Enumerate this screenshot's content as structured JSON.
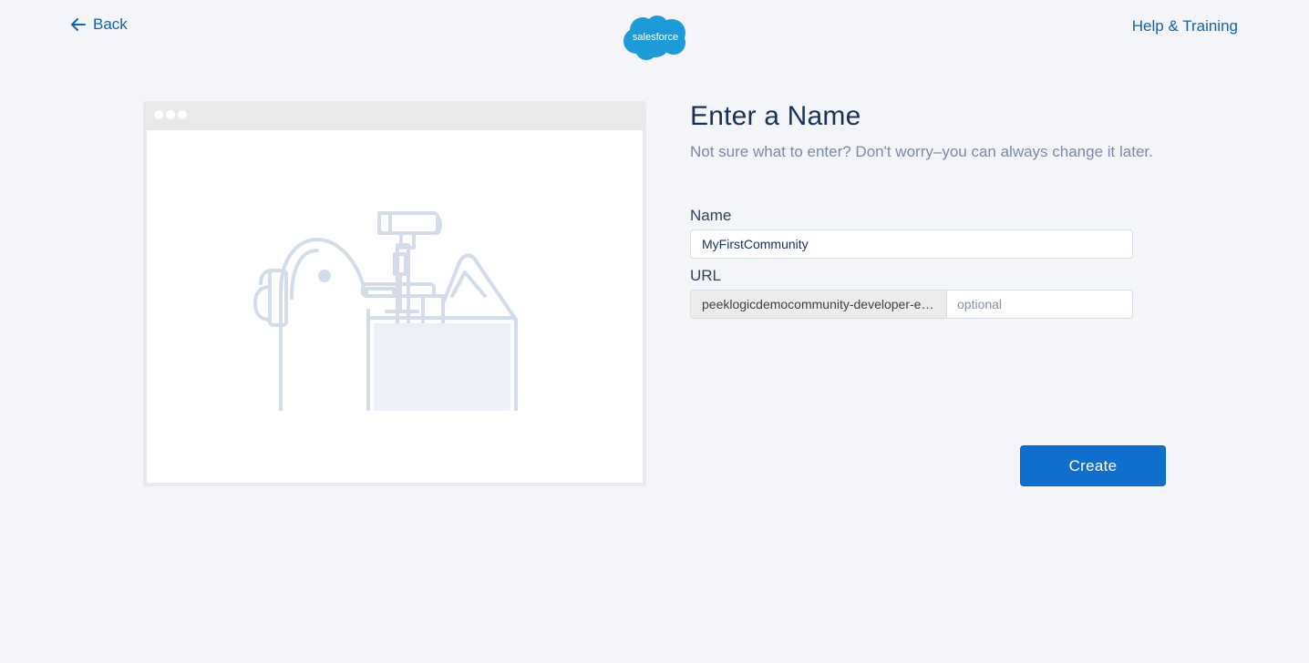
{
  "header": {
    "back_label": "Back",
    "logo_text": "salesforce",
    "help_label": "Help & Training"
  },
  "preview": {
    "illustration_icon": "toolbox-illustration"
  },
  "form": {
    "heading": "Enter a Name",
    "subheading": "Not sure what to enter? Don't worry–you can always change it later.",
    "name_label": "Name",
    "name_value": "MyFirstCommunity",
    "url_label": "URL",
    "url_prefix": "peeklogicdemocommunity-developer-edition...",
    "url_placeholder": "optional",
    "create_label": "Create"
  },
  "colors": {
    "accent": "#0e6fcf",
    "link": "#0b64b5",
    "background": "#f3f5f9",
    "logo_blue": "#1798c1"
  }
}
